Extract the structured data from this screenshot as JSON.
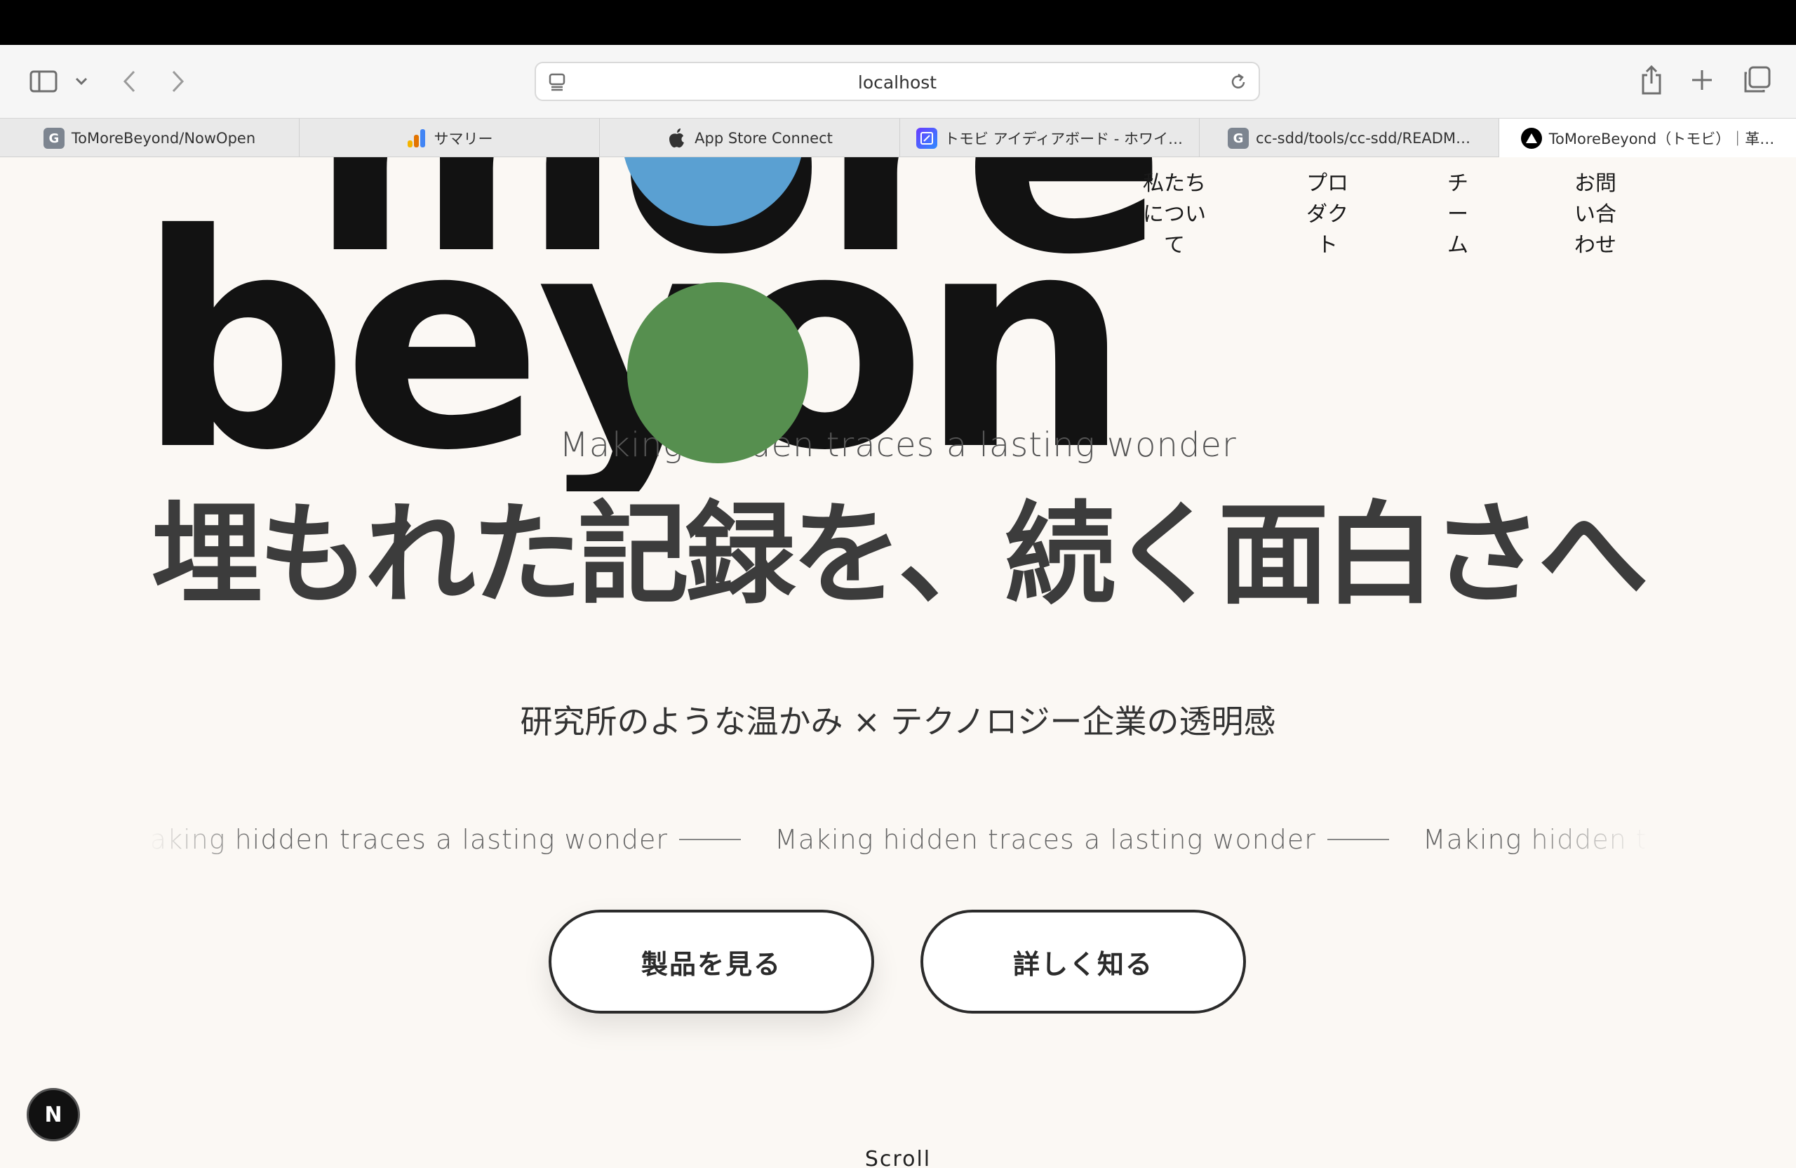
{
  "browser": {
    "address": "localhost",
    "tabs": [
      {
        "label": "ToMoreBeyond/NowOpen",
        "icon": "g-letter-icon"
      },
      {
        "label": "サマリー",
        "icon": "analytics-icon"
      },
      {
        "label": "App Store Connect",
        "icon": "apple-icon"
      },
      {
        "label": "トモビ アイディアボード - ホワイ…",
        "icon": "whiteboard-icon"
      },
      {
        "label": "cc-sdd/tools/cc-sdd/READM…",
        "icon": "g-letter-icon"
      },
      {
        "label": "ToMoreBeyond（トモビ）｜革…",
        "icon": "triangle-logo-icon",
        "active": true
      }
    ]
  },
  "site": {
    "logo_top": "more",
    "logo_bottom": "beyond",
    "nav": [
      {
        "label": "私たちについて",
        "lines": [
          "私たち",
          "につい",
          "て"
        ]
      },
      {
        "label": "プロダクト",
        "lines": [
          "プロ",
          "ダク",
          "ト"
        ]
      },
      {
        "label": "チーム",
        "lines": [
          "チ",
          "ー",
          "ム"
        ]
      },
      {
        "label": "お問い合わせ",
        "lines": [
          "お問",
          "い合",
          "わせ"
        ]
      }
    ],
    "tagline": "Making hidden traces a lasting wonder",
    "headline": "埋もれた記録を、続く面白さへ",
    "subheadline": "研究所のような温かみ × テクノロジー企業の透明感",
    "marquee_text": "Making hidden traces a lasting wonder",
    "buttons": {
      "products": "製品を見る",
      "learn_more": "詳しく知る"
    },
    "dev_badge": "N",
    "scroll": "Scroll"
  },
  "colors": {
    "background": "#fbf8f4",
    "logo_ink": "#121212",
    "dot_blue": "#5aa0d2",
    "dot_green": "#568f4f",
    "headline": "#3c3c3c"
  }
}
